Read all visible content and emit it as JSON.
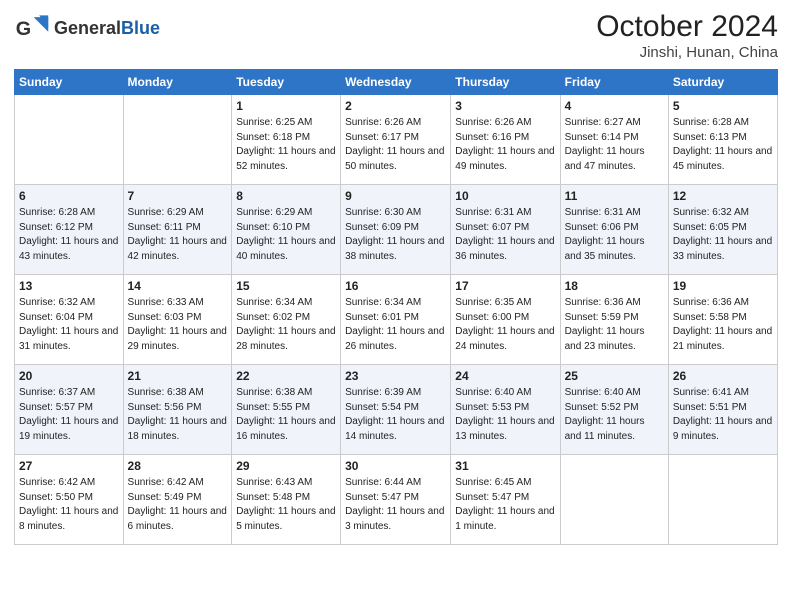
{
  "logo": {
    "text_general": "General",
    "text_blue": "Blue"
  },
  "title": "October 2024",
  "subtitle": "Jinshi, Hunan, China",
  "weekdays": [
    "Sunday",
    "Monday",
    "Tuesday",
    "Wednesday",
    "Thursday",
    "Friday",
    "Saturday"
  ],
  "weeks": [
    [
      {
        "day": "",
        "text": ""
      },
      {
        "day": "",
        "text": ""
      },
      {
        "day": "1",
        "text": "Sunrise: 6:25 AM\nSunset: 6:18 PM\nDaylight: 11 hours and 52 minutes."
      },
      {
        "day": "2",
        "text": "Sunrise: 6:26 AM\nSunset: 6:17 PM\nDaylight: 11 hours and 50 minutes."
      },
      {
        "day": "3",
        "text": "Sunrise: 6:26 AM\nSunset: 6:16 PM\nDaylight: 11 hours and 49 minutes."
      },
      {
        "day": "4",
        "text": "Sunrise: 6:27 AM\nSunset: 6:14 PM\nDaylight: 11 hours and 47 minutes."
      },
      {
        "day": "5",
        "text": "Sunrise: 6:28 AM\nSunset: 6:13 PM\nDaylight: 11 hours and 45 minutes."
      }
    ],
    [
      {
        "day": "6",
        "text": "Sunrise: 6:28 AM\nSunset: 6:12 PM\nDaylight: 11 hours and 43 minutes."
      },
      {
        "day": "7",
        "text": "Sunrise: 6:29 AM\nSunset: 6:11 PM\nDaylight: 11 hours and 42 minutes."
      },
      {
        "day": "8",
        "text": "Sunrise: 6:29 AM\nSunset: 6:10 PM\nDaylight: 11 hours and 40 minutes."
      },
      {
        "day": "9",
        "text": "Sunrise: 6:30 AM\nSunset: 6:09 PM\nDaylight: 11 hours and 38 minutes."
      },
      {
        "day": "10",
        "text": "Sunrise: 6:31 AM\nSunset: 6:07 PM\nDaylight: 11 hours and 36 minutes."
      },
      {
        "day": "11",
        "text": "Sunrise: 6:31 AM\nSunset: 6:06 PM\nDaylight: 11 hours and 35 minutes."
      },
      {
        "day": "12",
        "text": "Sunrise: 6:32 AM\nSunset: 6:05 PM\nDaylight: 11 hours and 33 minutes."
      }
    ],
    [
      {
        "day": "13",
        "text": "Sunrise: 6:32 AM\nSunset: 6:04 PM\nDaylight: 11 hours and 31 minutes."
      },
      {
        "day": "14",
        "text": "Sunrise: 6:33 AM\nSunset: 6:03 PM\nDaylight: 11 hours and 29 minutes."
      },
      {
        "day": "15",
        "text": "Sunrise: 6:34 AM\nSunset: 6:02 PM\nDaylight: 11 hours and 28 minutes."
      },
      {
        "day": "16",
        "text": "Sunrise: 6:34 AM\nSunset: 6:01 PM\nDaylight: 11 hours and 26 minutes."
      },
      {
        "day": "17",
        "text": "Sunrise: 6:35 AM\nSunset: 6:00 PM\nDaylight: 11 hours and 24 minutes."
      },
      {
        "day": "18",
        "text": "Sunrise: 6:36 AM\nSunset: 5:59 PM\nDaylight: 11 hours and 23 minutes."
      },
      {
        "day": "19",
        "text": "Sunrise: 6:36 AM\nSunset: 5:58 PM\nDaylight: 11 hours and 21 minutes."
      }
    ],
    [
      {
        "day": "20",
        "text": "Sunrise: 6:37 AM\nSunset: 5:57 PM\nDaylight: 11 hours and 19 minutes."
      },
      {
        "day": "21",
        "text": "Sunrise: 6:38 AM\nSunset: 5:56 PM\nDaylight: 11 hours and 18 minutes."
      },
      {
        "day": "22",
        "text": "Sunrise: 6:38 AM\nSunset: 5:55 PM\nDaylight: 11 hours and 16 minutes."
      },
      {
        "day": "23",
        "text": "Sunrise: 6:39 AM\nSunset: 5:54 PM\nDaylight: 11 hours and 14 minutes."
      },
      {
        "day": "24",
        "text": "Sunrise: 6:40 AM\nSunset: 5:53 PM\nDaylight: 11 hours and 13 minutes."
      },
      {
        "day": "25",
        "text": "Sunrise: 6:40 AM\nSunset: 5:52 PM\nDaylight: 11 hours and 11 minutes."
      },
      {
        "day": "26",
        "text": "Sunrise: 6:41 AM\nSunset: 5:51 PM\nDaylight: 11 hours and 9 minutes."
      }
    ],
    [
      {
        "day": "27",
        "text": "Sunrise: 6:42 AM\nSunset: 5:50 PM\nDaylight: 11 hours and 8 minutes."
      },
      {
        "day": "28",
        "text": "Sunrise: 6:42 AM\nSunset: 5:49 PM\nDaylight: 11 hours and 6 minutes."
      },
      {
        "day": "29",
        "text": "Sunrise: 6:43 AM\nSunset: 5:48 PM\nDaylight: 11 hours and 5 minutes."
      },
      {
        "day": "30",
        "text": "Sunrise: 6:44 AM\nSunset: 5:47 PM\nDaylight: 11 hours and 3 minutes."
      },
      {
        "day": "31",
        "text": "Sunrise: 6:45 AM\nSunset: 5:47 PM\nDaylight: 11 hours and 1 minute."
      },
      {
        "day": "",
        "text": ""
      },
      {
        "day": "",
        "text": ""
      }
    ]
  ]
}
